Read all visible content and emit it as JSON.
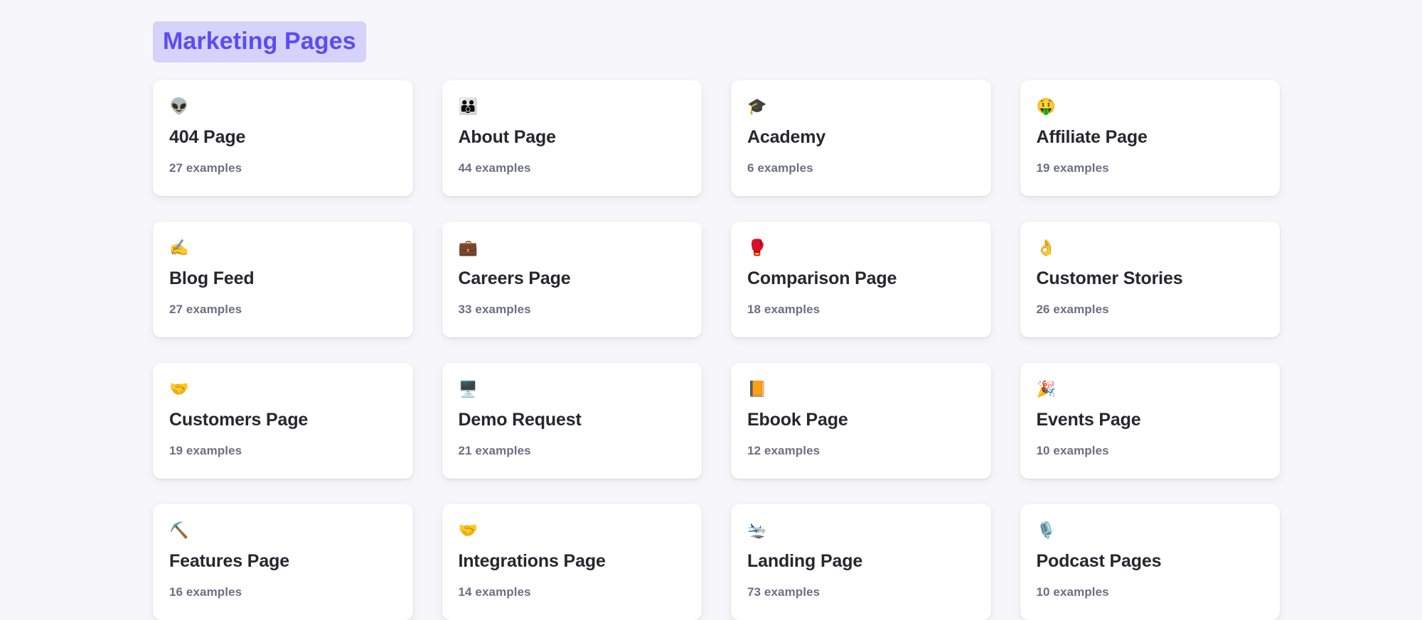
{
  "header": {
    "title": "Marketing Pages",
    "title_bg": "#d5d2fb",
    "title_color": "#5b4cf0"
  },
  "theme": {
    "background": "#f7f7fb",
    "card_background": "#ffffff",
    "title_text": "#26262e",
    "muted_text": "#6e6e83"
  },
  "cards": [
    {
      "emoji": "👽",
      "icon_name": "alien-icon",
      "title": "404 Page",
      "count": "27 examples"
    },
    {
      "emoji": "👪",
      "icon_name": "family-icon",
      "title": "About Page",
      "count": "44 examples"
    },
    {
      "emoji": "🎓",
      "icon_name": "graduation-cap-icon",
      "title": "Academy",
      "count": "6 examples"
    },
    {
      "emoji": "🤑",
      "icon_name": "money-mouth-face-icon",
      "title": "Affiliate Page",
      "count": "19 examples"
    },
    {
      "emoji": "✍️",
      "icon_name": "writing-hand-icon",
      "title": "Blog Feed",
      "count": "27 examples"
    },
    {
      "emoji": "💼",
      "icon_name": "briefcase-icon",
      "title": "Careers Page",
      "count": "33 examples"
    },
    {
      "emoji": "🥊",
      "icon_name": "boxing-glove-icon",
      "title": "Comparison Page",
      "count": "18 examples"
    },
    {
      "emoji": "👌",
      "icon_name": "ok-hand-icon",
      "title": "Customer Stories",
      "count": "26 examples"
    },
    {
      "emoji": "🤝",
      "icon_name": "handshake-icon",
      "title": "Customers Page",
      "count": "19 examples"
    },
    {
      "emoji": "🖥️",
      "icon_name": "desktop-computer-icon",
      "title": "Demo Request",
      "count": "21 examples"
    },
    {
      "emoji": "📙",
      "icon_name": "orange-book-icon",
      "title": "Ebook Page",
      "count": "12 examples"
    },
    {
      "emoji": "🎉",
      "icon_name": "party-popper-icon",
      "title": "Events Page",
      "count": "10 examples"
    },
    {
      "emoji": "⛏️",
      "icon_name": "pick-icon",
      "title": "Features Page",
      "count": "16 examples"
    },
    {
      "emoji": "🤝",
      "icon_name": "handshake-icon",
      "title": "Integrations Page",
      "count": "14 examples"
    },
    {
      "emoji": "🛬",
      "icon_name": "airplane-departure-icon",
      "title": "Landing Page",
      "count": "73 examples"
    },
    {
      "emoji": "🎙️",
      "icon_name": "studio-microphone-icon",
      "title": "Podcast Pages",
      "count": "10 examples"
    }
  ]
}
